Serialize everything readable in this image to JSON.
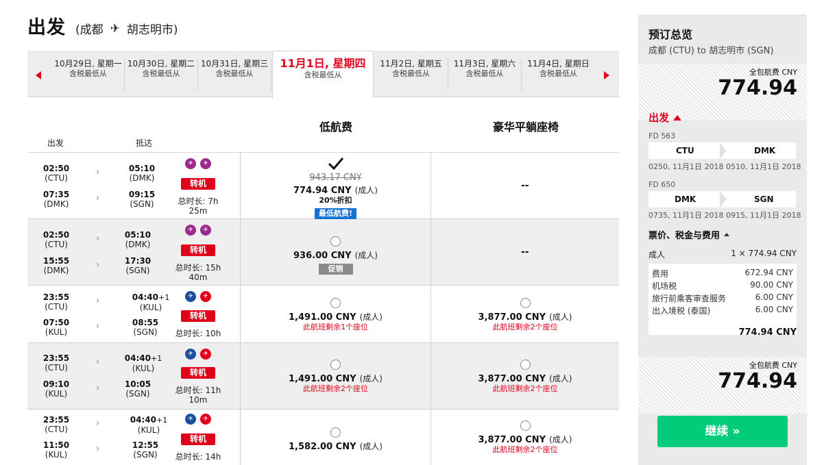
{
  "header": {
    "title": "出发",
    "origin": "(成都",
    "destination": "胡志明市)",
    "plane_icon": "plane-icon"
  },
  "dates": [
    {
      "label": "10月29日, 星期一",
      "sub": "含税最低从"
    },
    {
      "label": "10月30日, 星期二",
      "sub": "含税最低从"
    },
    {
      "label": "10月31日, 星期三",
      "sub": "含税最低从"
    },
    {
      "label": "11月1日, 星期四",
      "sub": "含税最低从",
      "active": true
    },
    {
      "label": "11月2日, 星期五",
      "sub": "含税最低从"
    },
    {
      "label": "11月3日, 星期六",
      "sub": "含税最低从"
    },
    {
      "label": "11月4日, 星期日",
      "sub": "含税最低从"
    }
  ],
  "columns": {
    "low_fare": "低航费",
    "premium": "豪华平躺座椅",
    "depart": "出发",
    "arrive": "抵达"
  },
  "flights": [
    {
      "seg1": {
        "dep_time": "02:50",
        "dep_code": "(CTU)",
        "arr_time": "05:10",
        "arr_code": "(DMK)"
      },
      "seg2": {
        "dep_time": "07:35",
        "dep_code": "(DMK)",
        "arr_time": "09:15",
        "arr_code": "(SGN)"
      },
      "transfer": "转机",
      "duration_1": "总时长: 7h",
      "duration_2": "25m",
      "low": {
        "old_price": "943.17 CNY",
        "price": "774.94 CNY",
        "adult": "(成人)",
        "discount": "20%折扣",
        "badge": "最低航费!"
      },
      "premium": "--"
    },
    {
      "seg1": {
        "dep_time": "02:50",
        "dep_code": "(CTU)",
        "arr_time": "05:10",
        "arr_code": "(DMK)"
      },
      "seg2": {
        "dep_time": "15:55",
        "dep_code": "(DMK)",
        "arr_time": "17:30",
        "arr_code": "(SGN)"
      },
      "transfer": "转机",
      "duration_1": "总时长: 15h",
      "duration_2": "40m",
      "low": {
        "price": "936.00 CNY",
        "adult": "(成人)",
        "badge": "促销"
      },
      "premium": "--"
    },
    {
      "seg1": {
        "dep_time": "23:55",
        "dep_code": "(CTU)",
        "arr_time": "04:40",
        "arr_plus": "+1",
        "arr_code": "(KUL)"
      },
      "seg2": {
        "dep_time": "07:50",
        "dep_code": "(KUL)",
        "arr_time": "08:55",
        "arr_code": "(SGN)"
      },
      "transfer": "转机",
      "duration_1": "总时长: 10h",
      "duration_2": "",
      "low": {
        "price": "1,491.00 CNY",
        "adult": "(成人)",
        "warning": "此航班剩余1个座位"
      },
      "premium": {
        "price": "3,877.00 CNY",
        "adult": "(成人)",
        "warning": "此航班剩余2个座位"
      }
    },
    {
      "seg1": {
        "dep_time": "23:55",
        "dep_code": "(CTU)",
        "arr_time": "04:40",
        "arr_plus": "+1",
        "arr_code": "(KUL)"
      },
      "seg2": {
        "dep_time": "09:10",
        "dep_code": "(KUL)",
        "arr_time": "10:05",
        "arr_code": "(SGN)"
      },
      "transfer": "转机",
      "duration_1": "总时长: 11h",
      "duration_2": "10m",
      "low": {
        "price": "1,491.00 CNY",
        "adult": "(成人)",
        "warning": "此航班剩余2个座位"
      },
      "premium": {
        "price": "3,877.00 CNY",
        "adult": "(成人)",
        "warning": "此航班剩余2个座位"
      }
    },
    {
      "seg1": {
        "dep_time": "23:55",
        "dep_code": "(CTU)",
        "arr_time": "04:40",
        "arr_plus": "+1",
        "arr_code": "(KUL)"
      },
      "seg2": {
        "dep_time": "11:50",
        "dep_code": "(KUL)",
        "arr_time": "12:55",
        "arr_code": "(SGN)"
      },
      "transfer": "转机",
      "duration_1": "总时长: 14h",
      "duration_2": "",
      "low": {
        "price": "1,582.00 CNY",
        "adult": "(成人)"
      },
      "premium": {
        "price": "3,877.00 CNY",
        "adult": "(成人)",
        "warning": "此航班剩余2个座位"
      }
    }
  ],
  "summary": {
    "title": "预订总览",
    "route": "成都 (CTU) to 胡志明市 (SGN)",
    "total_label": "全包航费 CNY",
    "total": "774.94",
    "depart_label": "出发",
    "segments": [
      {
        "flight": "FD 563",
        "from": "CTU",
        "to": "DMK",
        "time": "0250, 11月1日 2018 0510, 11月1日 2018"
      },
      {
        "flight": "FD 650",
        "from": "DMK",
        "to": "SGN",
        "time": "0735, 11月1日 2018 0915, 11月1日 2018"
      }
    ],
    "fee_header": "票价、税金与费用",
    "adult_label": "成人",
    "adult_value": "1 × 774.94 CNY",
    "fees": [
      {
        "label": "费用",
        "value": "672.94 CNY"
      },
      {
        "label": "机场税",
        "value": "90.00 CNY"
      },
      {
        "label": "旅行前乘客审查服务",
        "value": "6.00 CNY"
      },
      {
        "label": "出入境税 (泰国)",
        "value": "6.00 CNY"
      }
    ],
    "fees_total": "774.94 CNY",
    "continue_label": "继续 »"
  },
  "colors": {
    "accent_red": "#e0001b",
    "continue_green": "#00cc7a",
    "badge_blue": "#1372d4"
  }
}
